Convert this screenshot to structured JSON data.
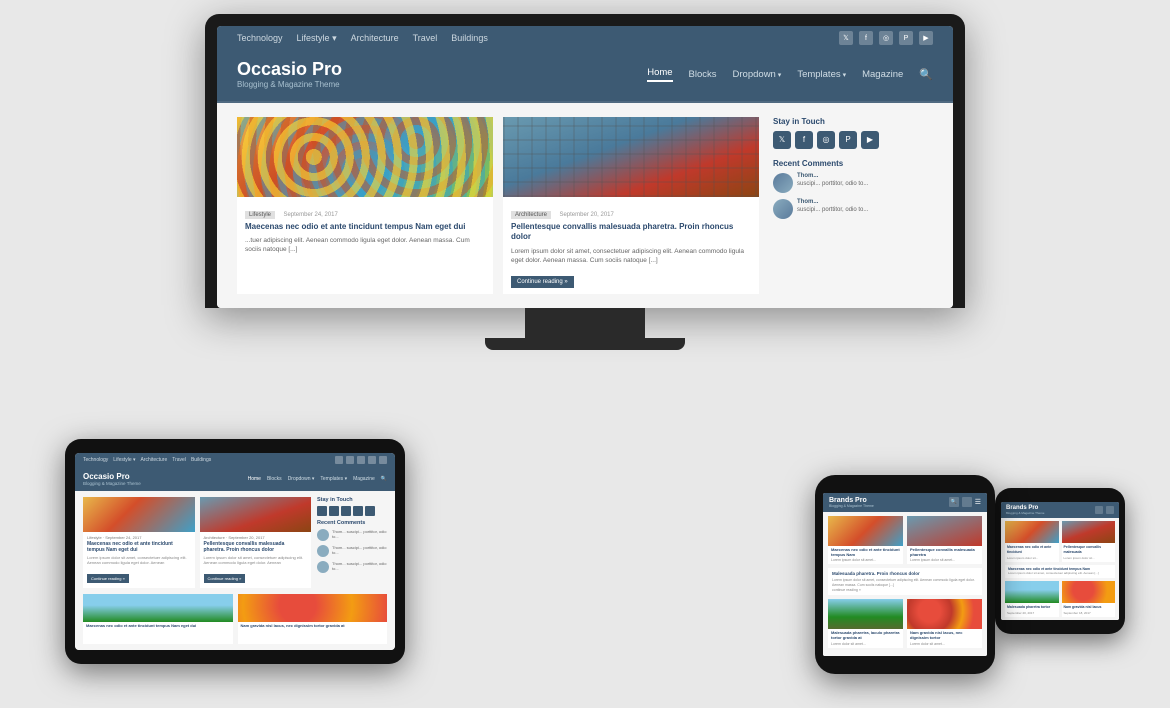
{
  "page": {
    "bg_color": "#e8e8e8"
  },
  "desktop": {
    "site": {
      "topbar_nav": [
        "Technology",
        "Lifestyle ▾",
        "Architecture",
        "Travel",
        "Buildings"
      ],
      "social_icons": [
        "tw",
        "fb",
        "ig",
        "pi",
        "yt"
      ],
      "logo_title": "Occasio Pro",
      "logo_subtitle": "Blogging & Magazine Theme",
      "nav_items": [
        "Home",
        "Blocks",
        "Dropdown ▾",
        "Templates ▾",
        "Magazine"
      ],
      "post1": {
        "tag": "Lifestyle",
        "date": "September 24, 2017",
        "title": "Maecenas nec odio et ante tincidunt tempus Nam eget dui",
        "excerpt": "...tuer adipiscing elit. Aenean commodo ligula eget dolor. Aenean massa. Cum sociis natoque [...]"
      },
      "post2": {
        "tag": "Architecture",
        "date": "September 20, 2017",
        "title": "Pellentesque convallis malesuada pharetra. Proin rhoncus dolor",
        "excerpt": "Lorem ipsum dolor sit amet, consectetuer adipiscing elit. Aenean commodo ligula eget dolor. Aenean massa. Cum sociis natoque [...]",
        "readmore": "Continue reading »"
      },
      "sidebar": {
        "widget1_title": "Stay in Touch",
        "widget2_title": "Recent Comments",
        "comments": [
          {
            "author": "Thom...",
            "text": "suscipi... porttitor, odio to..."
          },
          {
            "author": "Thom...",
            "text": "suscipi... porttitor, odio to..."
          }
        ]
      }
    }
  },
  "labels": {
    "templates": "Templates"
  }
}
